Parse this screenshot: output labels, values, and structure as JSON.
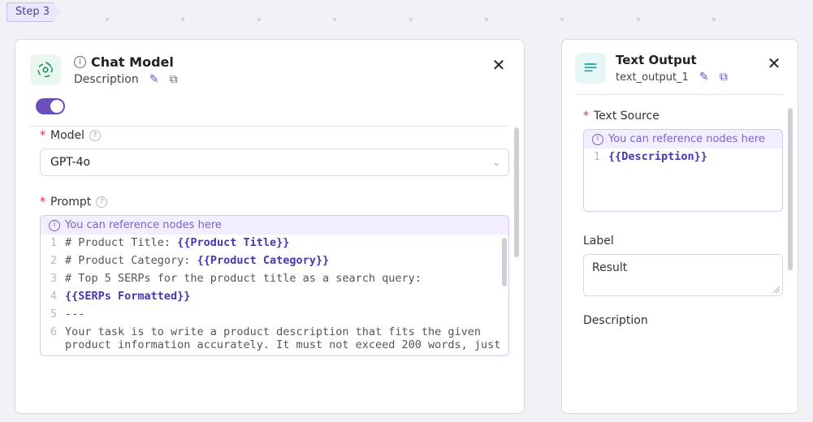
{
  "step": {
    "label": "Step 3"
  },
  "chat_panel": {
    "icon": "openai-logo-icon",
    "title": "Chat Model",
    "subtitle": "Description",
    "fields": {
      "model": {
        "label": "Model",
        "required": true,
        "value": "GPT-4o"
      },
      "prompt": {
        "label": "Prompt",
        "required": true,
        "hint": "You can reference nodes here",
        "lines": [
          {
            "n": 1,
            "segments": [
              {
                "t": "# Product Title: "
              },
              {
                "t": "{{Product Title}}",
                "tok": true
              }
            ]
          },
          {
            "n": 2,
            "segments": [
              {
                "t": "# Product Category: "
              },
              {
                "t": "{{Product Category}}",
                "tok": true
              }
            ]
          },
          {
            "n": 3,
            "segments": [
              {
                "t": "# Top 5 SERPs for the product title as a search query:"
              }
            ]
          },
          {
            "n": 4,
            "segments": [
              {
                "t": "{{SERPs Formatted}}",
                "tok": true
              }
            ]
          },
          {
            "n": 5,
            "segments": [
              {
                "t": "---"
              }
            ]
          },
          {
            "n": 6,
            "segments": [
              {
                "t": "Your task is to write a product description that fits the given product information accurately. It must not exceed 200 words, just"
              }
            ]
          }
        ]
      }
    }
  },
  "output_panel": {
    "icon": "text-lines-icon",
    "title": "Text Output",
    "subtitle": "text_output_1",
    "fields": {
      "text_source": {
        "label": "Text Source",
        "required": true,
        "hint": "You can reference nodes here",
        "lines": [
          {
            "n": 1,
            "segments": [
              {
                "t": "{{Description}}",
                "tok": true
              }
            ]
          }
        ]
      },
      "label": {
        "label": "Label",
        "value": "Result"
      },
      "description": {
        "label": "Description"
      }
    }
  },
  "icons": {
    "edit": "✎",
    "copy": "⧉",
    "close": "✕",
    "chevron_down": "⌄",
    "info": "i"
  }
}
